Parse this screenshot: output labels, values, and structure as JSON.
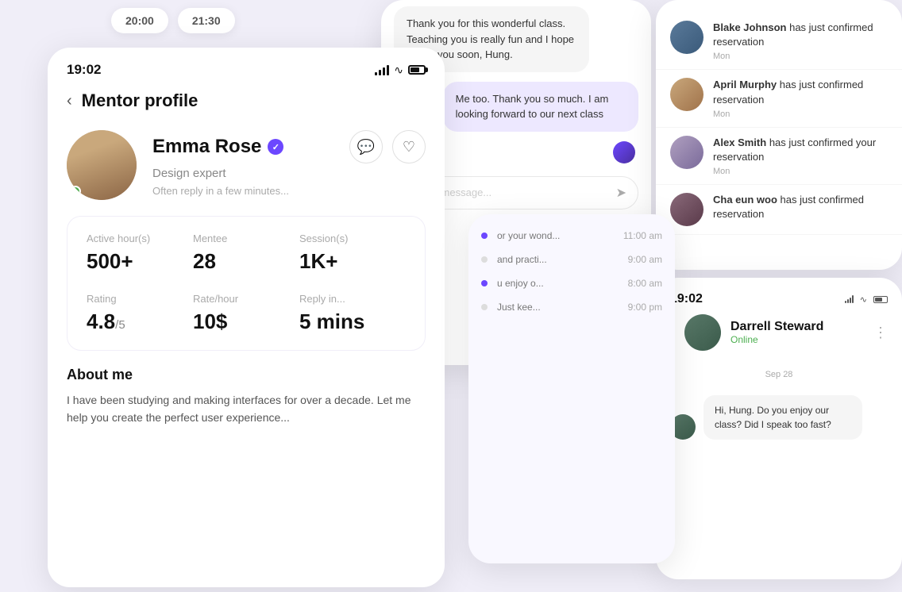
{
  "time_pills": [
    "20:00",
    "21:30"
  ],
  "mentor_card": {
    "status_bar": {
      "time": "19:02"
    },
    "back_label": "Mentor profile",
    "mentor_name": "Emma Rose",
    "mentor_role": "Design expert",
    "mentor_reply": "Often reply in a few minutes...",
    "stats": [
      {
        "label": "Active hour(s)",
        "value": "500+",
        "sub": ""
      },
      {
        "label": "Mentee",
        "value": "28",
        "sub": ""
      },
      {
        "label": "Session(s)",
        "value": "1K+",
        "sub": ""
      },
      {
        "label": "Rating",
        "value": "4.8",
        "sub": "/5"
      },
      {
        "label": "Rate/hour",
        "value": "10$",
        "sub": ""
      },
      {
        "label": "Reply in...",
        "value": "5 mins",
        "sub": ""
      }
    ],
    "about_title": "About me",
    "about_text": "I have been studying and making interfaces for over a decade. Let me help you create the perfect user experience..."
  },
  "chat_card": {
    "messages": [
      {
        "type": "received",
        "text": "Thank you for this wonderful class. Teaching you is really fun and I hope to see you soon, Hung."
      },
      {
        "type": "sent",
        "text": "Me too. Thank you so much. I am looking forward to our next class"
      }
    ],
    "input_placeholder": "Write a message..."
  },
  "schedule_card": {
    "items": [
      {
        "text": "or your wond...",
        "time": "11:00 am",
        "dot": "purple"
      },
      {
        "text": "and practi...",
        "time": "9:00 am",
        "dot": "gray"
      },
      {
        "text": "u enjoy o...",
        "time": "8:00 am",
        "dot": "purple"
      },
      {
        "text": "Just kee...",
        "time": "9:00 pm",
        "dot": "gray"
      }
    ]
  },
  "notifications_card": {
    "items": [
      {
        "name": "Blake Johnson",
        "action": "has just confirmed reservation",
        "time": "Mon",
        "avatar_class": "avatar-blake"
      },
      {
        "name": "April Murphy",
        "action": "has just confirmed reservation",
        "time": "Mon",
        "avatar_class": "avatar-april"
      },
      {
        "name": "Alex Smith",
        "action": "has just confirmed your reservation",
        "time": "Mon",
        "avatar_class": "avatar-alex"
      },
      {
        "name": "Cha eun woo",
        "action": "has just confirmed reservation",
        "time": "",
        "avatar_class": "avatar-cha"
      }
    ]
  },
  "chat_detail_card": {
    "time": "19:02",
    "person_name": "Darrell Steward",
    "person_status": "Online",
    "date_sep": "Sep 28",
    "message": "Hi, Hung. Do you enjoy our class? Did I speak too fast?"
  }
}
